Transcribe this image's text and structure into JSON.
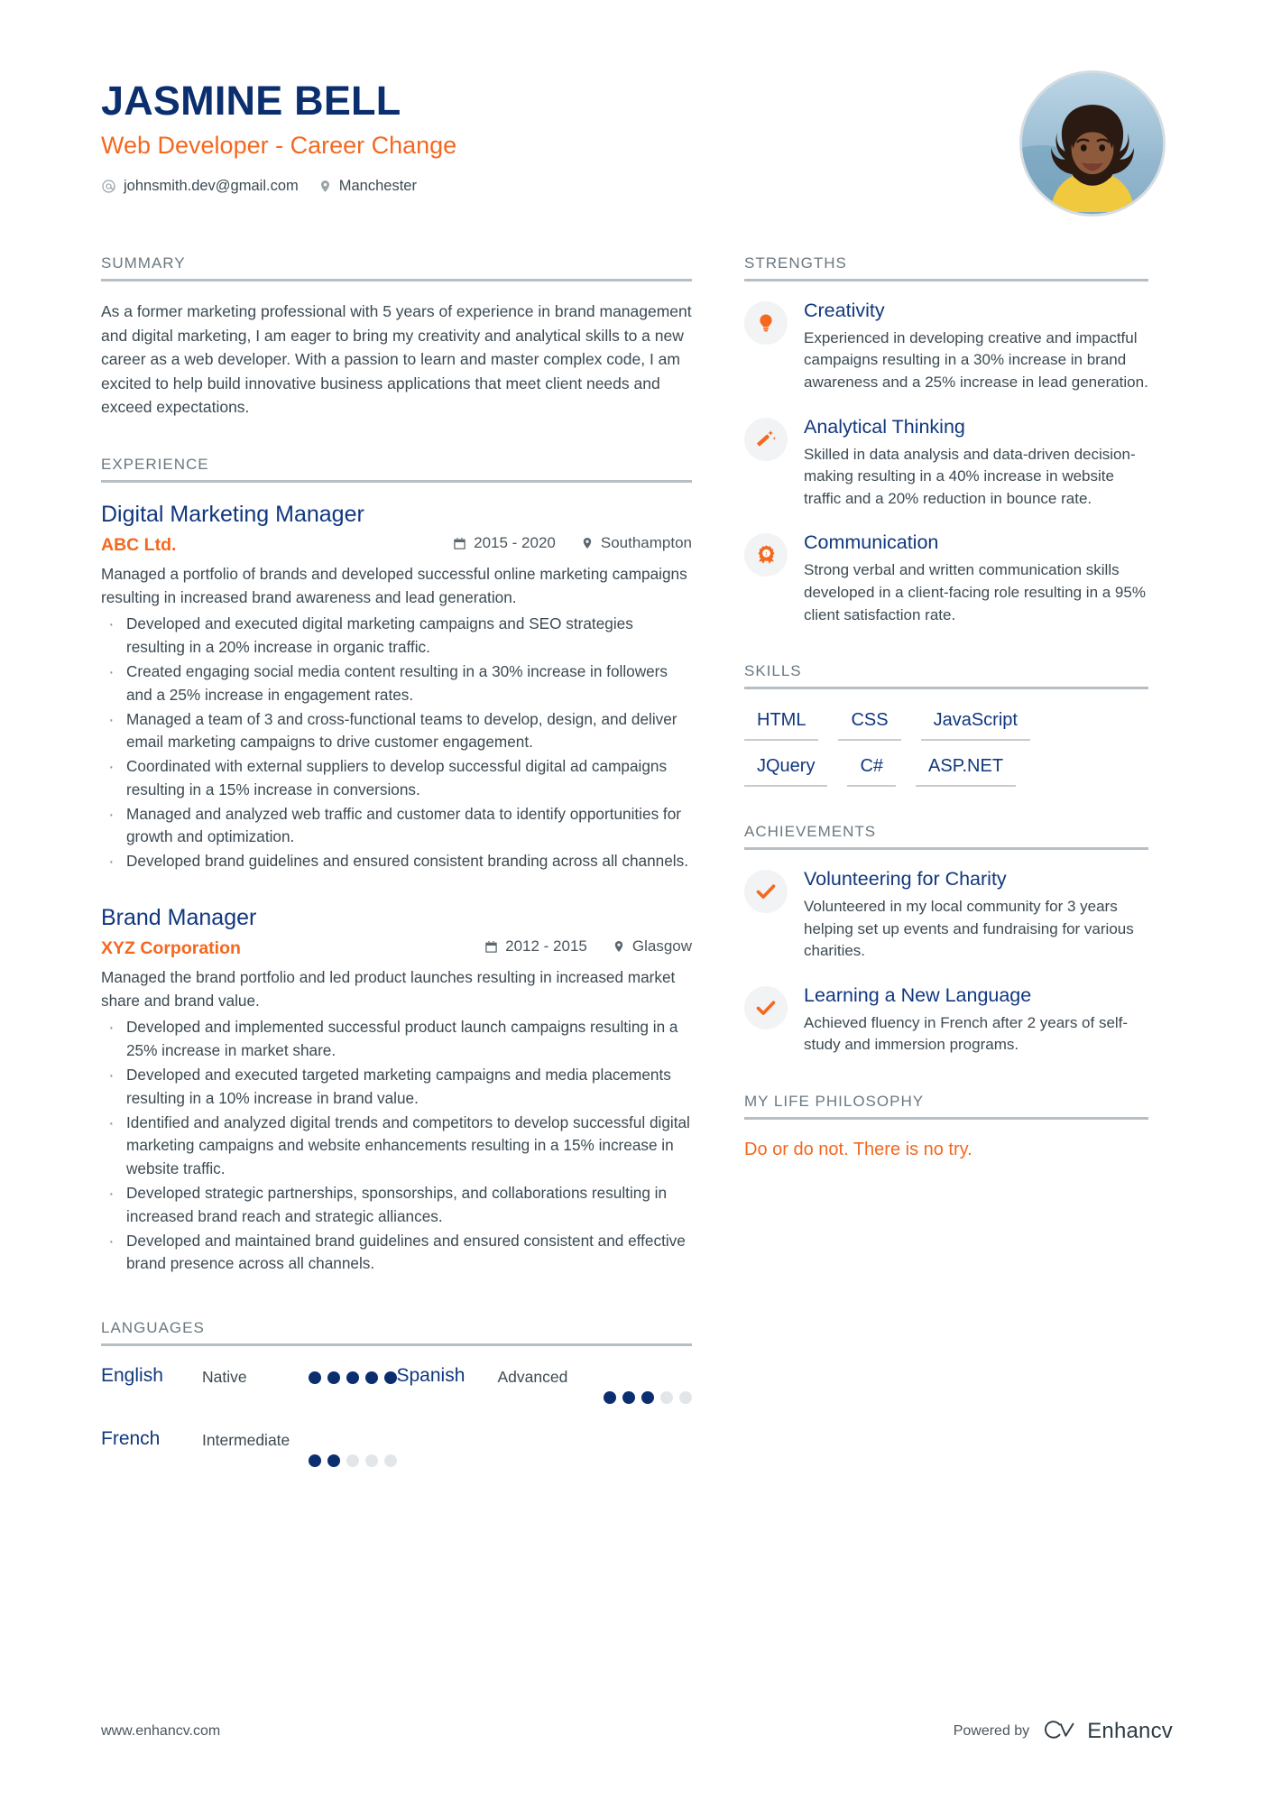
{
  "header": {
    "name": "JASMINE BELL",
    "job_title": "Web Developer - Career Change",
    "email": "johnsmith.dev@gmail.com",
    "location": "Manchester",
    "email_icon": "at-icon",
    "location_icon": "map-pin-icon",
    "avatar_alt": "profile-photo"
  },
  "colors": {
    "navy": "#0b2e6f",
    "title_navy": "#10377e",
    "orange": "#f4681f",
    "body_text": "#3c4a52",
    "rule": "#b7bfc4",
    "icon_bg": "#f2f3f4"
  },
  "sections": {
    "summary": "SUMMARY",
    "experience": "EXPERIENCE",
    "languages": "LANGUAGES",
    "strengths": "STRENGTHS",
    "skills": "SKILLS",
    "achievements": "ACHIEVEMENTS",
    "philosophy": "MY LIFE PHILOSOPHY"
  },
  "summary": {
    "text": "As a former marketing professional with 5 years of experience in brand management and digital marketing, I am eager to bring my creativity and analytical skills to a new career as a web developer. With a passion to learn and master complex code, I am excited to help build innovative business applications that meet client needs and exceed expectations."
  },
  "experience": [
    {
      "title": "Digital Marketing Manager",
      "company": "ABC Ltd.",
      "dates": "2015 - 2020",
      "location": "Southampton",
      "description": "Managed a portfolio of brands and developed successful online marketing campaigns resulting in increased brand awareness and lead generation.",
      "bullets": [
        "Developed and executed digital marketing campaigns and SEO strategies resulting in a 20% increase in organic traffic.",
        "Created engaging social media content resulting in a 30% increase in followers and a 25% increase in engagement rates.",
        "Managed a team of 3 and cross-functional teams to develop, design, and deliver email marketing campaigns to drive customer engagement.",
        "Coordinated with external suppliers to develop successful digital ad campaigns resulting in a 15% increase in conversions.",
        "Managed and analyzed web traffic and customer data to identify opportunities for growth and optimization.",
        "Developed brand guidelines and ensured consistent branding across all channels."
      ]
    },
    {
      "title": "Brand Manager",
      "company": "XYZ Corporation",
      "dates": "2012 - 2015",
      "location": "Glasgow",
      "description": "Managed the brand portfolio and led product launches resulting in increased market share and brand value.",
      "bullets": [
        "Developed and implemented successful product launch campaigns resulting in a 25% increase in market share.",
        "Developed and executed targeted marketing campaigns and media placements resulting in a 10% increase in brand value.",
        "Identified and analyzed digital trends and competitors to develop successful digital marketing campaigns and website enhancements resulting in a 15% increase in website traffic.",
        "Developed strategic partnerships, sponsorships, and collaborations resulting in increased brand reach and strategic alliances.",
        "Developed and maintained brand guidelines and ensured consistent and effective brand presence across all channels."
      ]
    }
  ],
  "languages": [
    {
      "name": "English",
      "level": "Native",
      "rating": 5,
      "max": 5
    },
    {
      "name": "Spanish",
      "level": "Advanced",
      "rating": 3,
      "max": 5
    },
    {
      "name": "French",
      "level": "Intermediate",
      "rating": 2,
      "max": 5
    }
  ],
  "strengths": [
    {
      "icon": "lightbulb-icon",
      "title": "Creativity",
      "text": "Experienced in developing creative and impactful campaigns resulting in a 30% increase in brand awareness and a 25% increase in lead generation."
    },
    {
      "icon": "magic-wand-icon",
      "title": "Analytical Thinking",
      "text": "Skilled in data analysis and data-driven decision-making resulting in a 40% increase in website traffic and a 20% reduction in bounce rate."
    },
    {
      "icon": "award-ribbon-icon",
      "title": "Communication",
      "text": "Strong verbal and written communication skills developed in a client-facing role resulting in a 95% client satisfaction rate."
    }
  ],
  "skills": {
    "row1": [
      "HTML",
      "CSS",
      "JavaScript"
    ],
    "row2": [
      "JQuery",
      "C#",
      "ASP.NET"
    ]
  },
  "achievements": [
    {
      "icon": "check-icon",
      "title": "Volunteering for Charity",
      "text": "Volunteered in my local community for 3 years helping set up events and fundraising for various charities."
    },
    {
      "icon": "check-icon",
      "title": "Learning a New Language",
      "text": "Achieved fluency in French after 2 years of self-study and immersion programs."
    }
  ],
  "philosophy": {
    "quote": "Do or do not. There is no try."
  },
  "footer": {
    "url": "www.enhancv.com",
    "powered_by": "Powered by",
    "brand": "Enhancv"
  }
}
